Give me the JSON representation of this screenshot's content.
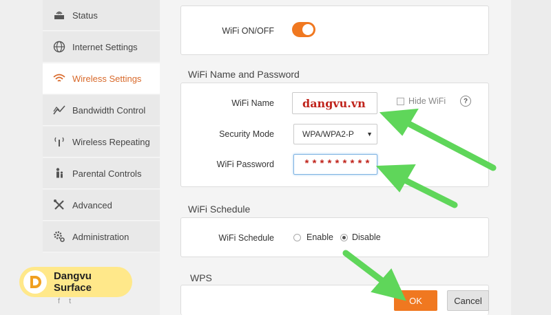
{
  "sidebar": {
    "items": [
      {
        "label": "Status",
        "icon": "router-icon",
        "active": false
      },
      {
        "label": "Internet Settings",
        "icon": "globe-icon",
        "active": false
      },
      {
        "label": "Wireless Settings",
        "icon": "wifi-icon",
        "active": true
      },
      {
        "label": "Bandwidth Control",
        "icon": "chart-line-icon",
        "active": false
      },
      {
        "label": "Wireless Repeating",
        "icon": "repeater-icon",
        "active": false
      },
      {
        "label": "Parental Controls",
        "icon": "family-icon",
        "active": false
      },
      {
        "label": "Advanced",
        "icon": "tools-icon",
        "active": false
      },
      {
        "label": "Administration",
        "icon": "gears-icon",
        "active": false
      }
    ],
    "brand": "Dangvu Surface",
    "social": "f t"
  },
  "wifi_toggle": {
    "label": "WiFi ON/OFF",
    "on": true
  },
  "name_password": {
    "title": "WiFi Name and Password",
    "name_label": "WiFi Name",
    "name_value": "dangvu.vn",
    "hide_label": "Hide WiFi",
    "hide_checked": false,
    "help": "?",
    "security_label": "Security Mode",
    "security_value": "WPA/WPA2-P",
    "password_label": "WiFi Password",
    "password_value": "*********"
  },
  "schedule": {
    "title": "WiFi Schedule",
    "label": "WiFi Schedule",
    "enable_label": "Enable",
    "disable_label": "Disable",
    "selected": "Disable"
  },
  "wps": {
    "title": "WPS"
  },
  "actions": {
    "ok_label": "OK",
    "cancel_label": "Cancel"
  },
  "colors": {
    "accent": "#f07820",
    "active_nav": "#d8692a",
    "arrow": "#5fd65a"
  }
}
